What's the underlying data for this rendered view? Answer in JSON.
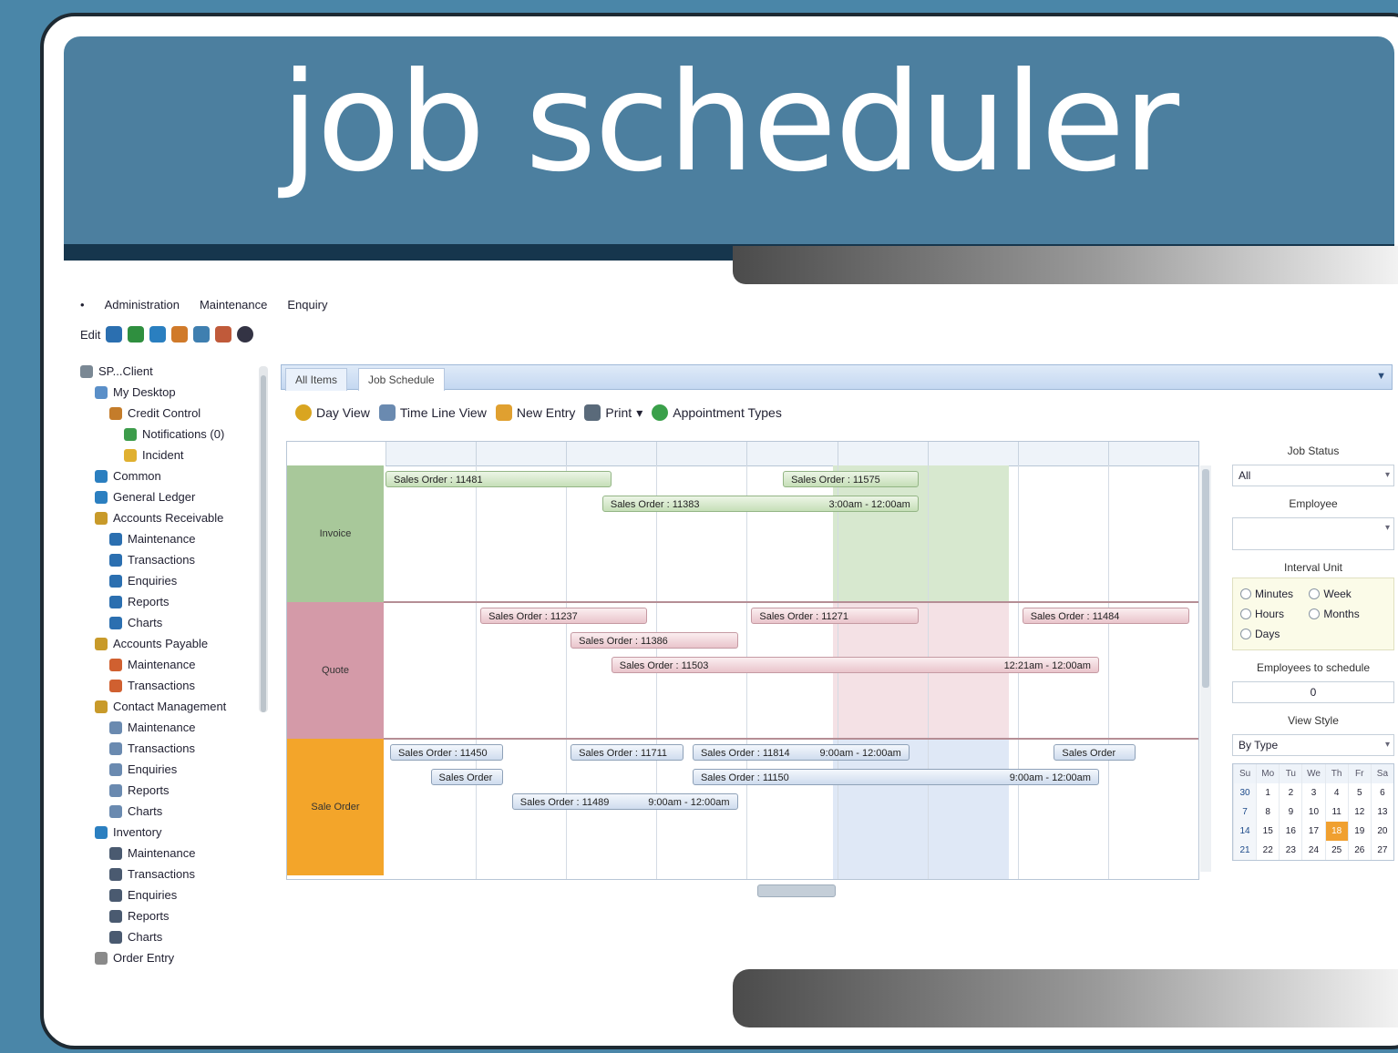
{
  "banner": {
    "title": "job scheduler"
  },
  "menu": [
    "Administration",
    "Maintenance",
    "Enquiry"
  ],
  "toolbar_top": {
    "edit_label": "Edit"
  },
  "tree": [
    {
      "label": "SP...Client",
      "color": "#7a8894",
      "indent": 0
    },
    {
      "label": "My Desktop",
      "color": "#5a8fc8",
      "indent": 1
    },
    {
      "label": "Credit Control",
      "color": "#c47c2a",
      "indent": 2
    },
    {
      "label": "Notifications (0)",
      "color": "#3d9c4b",
      "indent": 3
    },
    {
      "label": "Incident",
      "color": "#e0b030",
      "indent": 3
    },
    {
      "label": "Common",
      "color": "#2b7fc0",
      "indent": 1
    },
    {
      "label": "General Ledger",
      "color": "#2b7fc0",
      "indent": 1
    },
    {
      "label": "Accounts Receivable",
      "color": "#c89a2a",
      "indent": 1
    },
    {
      "label": "Maintenance",
      "color": "#2b6fb0",
      "indent": 2
    },
    {
      "label": "Transactions",
      "color": "#2b6fb0",
      "indent": 2
    },
    {
      "label": "Enquiries",
      "color": "#2b6fb0",
      "indent": 2
    },
    {
      "label": "Reports",
      "color": "#2b6fb0",
      "indent": 2
    },
    {
      "label": "Charts",
      "color": "#2b6fb0",
      "indent": 2
    },
    {
      "label": "Accounts Payable",
      "color": "#c89a2a",
      "indent": 1
    },
    {
      "label": "Maintenance",
      "color": "#d06030",
      "indent": 2
    },
    {
      "label": "Transactions",
      "color": "#d06030",
      "indent": 2
    },
    {
      "label": "Contact Management",
      "color": "#c89a2a",
      "indent": 1
    },
    {
      "label": "Maintenance",
      "color": "#6a8ab0",
      "indent": 2
    },
    {
      "label": "Transactions",
      "color": "#6a8ab0",
      "indent": 2
    },
    {
      "label": "Enquiries",
      "color": "#6a8ab0",
      "indent": 2
    },
    {
      "label": "Reports",
      "color": "#6a8ab0",
      "indent": 2
    },
    {
      "label": "Charts",
      "color": "#6a8ab0",
      "indent": 2
    },
    {
      "label": "Inventory",
      "color": "#2b7fc0",
      "indent": 1
    },
    {
      "label": "Maintenance",
      "color": "#4a5a70",
      "indent": 2
    },
    {
      "label": "Transactions",
      "color": "#4a5a70",
      "indent": 2
    },
    {
      "label": "Enquiries",
      "color": "#4a5a70",
      "indent": 2
    },
    {
      "label": "Reports",
      "color": "#4a5a70",
      "indent": 2
    },
    {
      "label": "Charts",
      "color": "#4a5a70",
      "indent": 2
    },
    {
      "label": "Order Entry",
      "color": "#8a8a8a",
      "indent": 1
    }
  ],
  "doc_tabs": [
    "All Items",
    "Job Schedule"
  ],
  "sched_toolbar": [
    "Day View",
    "Time Line View",
    "New Entry",
    "Print",
    "Appointment Types"
  ],
  "rows": [
    {
      "label": "Invoice",
      "color": "#93b585",
      "bg": "#a8c89a"
    },
    {
      "label": "Quote",
      "color": "#c98a98",
      "bg": "#d49aa8"
    },
    {
      "label": "Sale Order",
      "color": "#f0a020",
      "bg": "#f3a52a"
    }
  ],
  "appointments": [
    {
      "text": "Sales Order : 11481",
      "time": "",
      "row": 0,
      "lane": 0,
      "start": 0,
      "end": 2.5,
      "style": "green"
    },
    {
      "text": "Sales Order : 11575",
      "time": "",
      "row": 0,
      "lane": 0,
      "start": 4.4,
      "end": 5.9,
      "style": "green"
    },
    {
      "text": "Sales Order : 11383",
      "time": "3:00am - 12:00am",
      "row": 0,
      "lane": 1,
      "start": 2.4,
      "end": 5.9,
      "style": "green"
    },
    {
      "text": "Sales Order : 11237",
      "time": "",
      "row": 1,
      "lane": 0,
      "start": 1.05,
      "end": 2.9,
      "style": "pink"
    },
    {
      "text": "Sales Order : 11271",
      "time": "",
      "row": 1,
      "lane": 0,
      "start": 4.05,
      "end": 5.9,
      "style": "pink"
    },
    {
      "text": "Sales Order : 11484",
      "time": "",
      "row": 1,
      "lane": 0,
      "start": 7.05,
      "end": 8.9,
      "style": "pink"
    },
    {
      "text": "Sales Order : 11386",
      "time": "",
      "row": 1,
      "lane": 1,
      "start": 2.05,
      "end": 3.9,
      "style": "pink"
    },
    {
      "text": "Sales Order : 11503",
      "time": "12:21am - 12:00am",
      "row": 1,
      "lane": 2,
      "start": 2.5,
      "end": 7.9,
      "style": "pink"
    },
    {
      "text": "Sales Order : 11450",
      "time": "",
      "row": 2,
      "lane": 0,
      "start": 0.05,
      "end": 1.3,
      "style": "blue"
    },
    {
      "text": "Sales Order : 11711",
      "time": "",
      "row": 2,
      "lane": 0,
      "start": 2.05,
      "end": 3.3,
      "style": "blue"
    },
    {
      "text": "Sales Order : 11814",
      "time": "9:00am - 12:00am",
      "row": 2,
      "lane": 0,
      "start": 3.4,
      "end": 5.8,
      "style": "blue"
    },
    {
      "text": "Sales Order",
      "time": "",
      "row": 2,
      "lane": 0,
      "start": 7.4,
      "end": 8.3,
      "style": "blue"
    },
    {
      "text": "Sales Order",
      "time": "",
      "row": 2,
      "lane": 1,
      "start": 0.5,
      "end": 1.3,
      "style": "blue"
    },
    {
      "text": "Sales Order : 11150",
      "time": "9:00am - 12:00am",
      "row": 2,
      "lane": 1,
      "start": 3.4,
      "end": 7.9,
      "style": "blue"
    },
    {
      "text": "Sales Order : 11489",
      "time": "9:00am - 12:00am",
      "row": 2,
      "lane": 2,
      "start": 1.4,
      "end": 3.9,
      "style": "blue"
    }
  ],
  "side": {
    "job_status_label": "Job Status",
    "job_status_value": "All",
    "employee_label": "Employee",
    "employee_value": "",
    "interval_label": "Interval Unit",
    "interval_options": [
      "Minutes",
      "Week",
      "Hours",
      "Months",
      "Days"
    ],
    "employees_label": "Employees to schedule",
    "employees_value": "0",
    "view_style_label": "View Style",
    "view_style_value": "By Type",
    "calendar_head": [
      "Su",
      "Mo",
      "Tu",
      "We",
      "Th",
      "Fr",
      "Sa"
    ],
    "calendar_weeks": [
      [
        "30",
        "1",
        "2",
        "3",
        "4",
        "5",
        "6"
      ],
      [
        "7",
        "8",
        "9",
        "10",
        "11",
        "12",
        "13"
      ],
      [
        "14",
        "15",
        "16",
        "17",
        "18",
        "19",
        "20"
      ],
      [
        "21",
        "22",
        "23",
        "24",
        "25",
        "26",
        "27"
      ]
    ],
    "calendar_today": "18"
  }
}
